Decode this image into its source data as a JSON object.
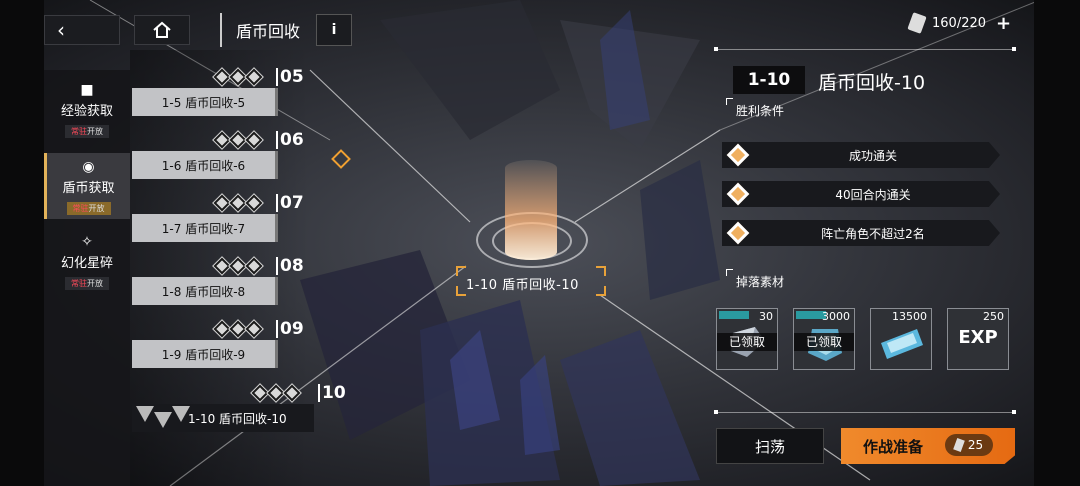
{
  "topbar": {
    "back_icon": "chevron-left",
    "home_icon": "home",
    "title": "盾币回收",
    "info_label": "i"
  },
  "stamina": {
    "value": "160/220",
    "plus": "+"
  },
  "categories": [
    {
      "label": "经验获取",
      "sub_red": "常驻",
      "sub_rest": "开放",
      "icon": "film-icon",
      "glyph": "■"
    },
    {
      "label": "盾币获取",
      "sub_red": "常驻",
      "sub_rest": "开放",
      "icon": "coin-icon",
      "glyph": "◉",
      "active": true
    },
    {
      "label": "幻化星碎",
      "sub_red": "常驻",
      "sub_rest": "开放",
      "icon": "star-shard-icon",
      "glyph": "✧"
    }
  ],
  "stages": [
    {
      "num": "05",
      "name": "1-5 盾币回收-5"
    },
    {
      "num": "06",
      "name": "1-6 盾币回收-6"
    },
    {
      "num": "07",
      "name": "1-7 盾币回收-7"
    },
    {
      "num": "08",
      "name": "1-8 盾币回收-8"
    },
    {
      "num": "09",
      "name": "1-9 盾币回收-9"
    },
    {
      "num": "10",
      "name": "1-10 盾币回收-10",
      "current": true
    }
  ],
  "map": {
    "node_label": "1-10 盾币回收-10"
  },
  "detail": {
    "stage_id": "1-10",
    "stage_name": "盾币回收-10",
    "victory_header": "胜利条件",
    "conditions": [
      "成功通关",
      "40回合内通关",
      "阵亡角色不超过2名"
    ],
    "drops_header": "掉落素材",
    "drops": [
      {
        "count": "30",
        "claimed": "已领取",
        "icon": "material-cube-icon"
      },
      {
        "count": "3000",
        "claimed": "已领取",
        "icon": "shield-coin-icon"
      },
      {
        "count": "13500",
        "icon": "ticket-icon"
      },
      {
        "count": "250",
        "icon": "exp-icon",
        "label": "EXP"
      }
    ]
  },
  "actions": {
    "sweep_label": "扫荡",
    "start_label": "作战准备",
    "cost": "25"
  },
  "colors": {
    "accent": "#e56a12",
    "gold": "#e3b35a",
    "marker": "#f1a031"
  }
}
